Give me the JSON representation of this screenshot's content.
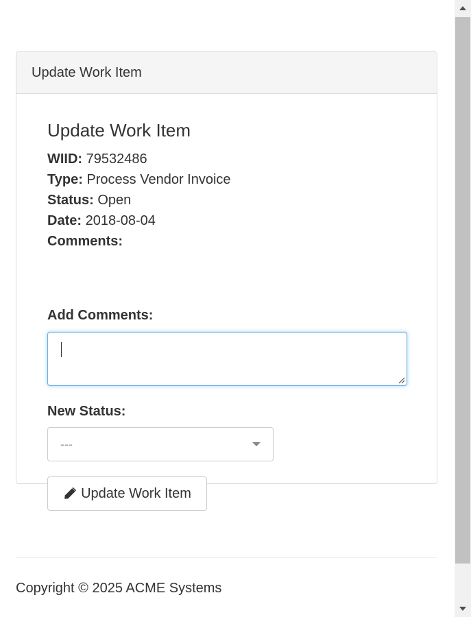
{
  "panel": {
    "heading": "Update Work Item"
  },
  "work_item": {
    "title": "Update Work Item",
    "wiid_label": "WIID:",
    "wiid_value": "79532486",
    "type_label": "Type:",
    "type_value": "Process Vendor Invoice",
    "status_label": "Status:",
    "status_value": "Open",
    "date_label": "Date:",
    "date_value": "2018-08-04",
    "comments_label": "Comments:",
    "comments_value": ""
  },
  "form": {
    "add_comments_label": "Add Comments:",
    "add_comments_value": "",
    "new_status_label": "New Status:",
    "new_status_selected": "---",
    "submit_label": "Update Work Item",
    "submit_icon": "pencil-icon"
  },
  "footer": {
    "copyright": "Copyright © 2025 ACME Systems"
  },
  "colors": {
    "focus_border": "#66afe9",
    "panel_heading_bg": "#f5f5f5",
    "border": "#dddddd",
    "text": "#333333",
    "placeholder": "#999999"
  }
}
